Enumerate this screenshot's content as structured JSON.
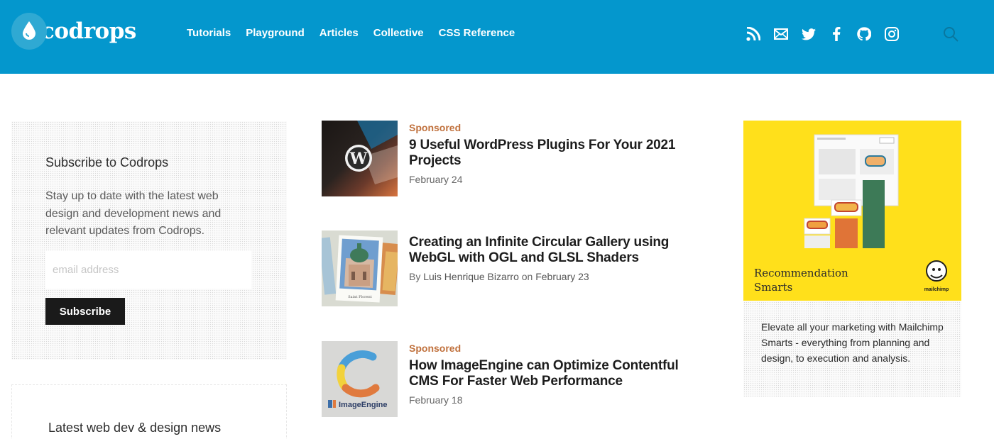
{
  "header": {
    "logo_text": "codrops",
    "nav": [
      "Tutorials",
      "Playground",
      "Articles",
      "Collective",
      "CSS Reference"
    ],
    "social_icons": [
      "rss-icon",
      "mail-icon",
      "twitter-icon",
      "facebook-icon",
      "github-icon",
      "instagram-icon"
    ],
    "search_icon": "search-icon",
    "bg_color": "#0497cd"
  },
  "subscribe": {
    "heading": "Subscribe to Codrops",
    "description": "Stay up to date with the latest web design and development news and relevant updates from Codrops.",
    "email_placeholder": "email address",
    "button_label": "Subscribe"
  },
  "news": {
    "heading": "Latest web dev & design news"
  },
  "articles": [
    {
      "label": "Sponsored",
      "title": "9 Useful WordPress Plugins For Your 2021 Projects",
      "date": "February 24"
    },
    {
      "title": "Creating an Infinite Circular Gallery using WebGL with OGL and GLSL Shaders",
      "by": "By",
      "author": "Luis Henrique Bizarro",
      "on": "on",
      "date": "February 23",
      "thumb_caption": "Saint Florent"
    },
    {
      "label": "Sponsored",
      "title": "How ImageEngine can Optimize Contentful CMS For Faster Web Performance",
      "date": "February 18",
      "thumb_brand": "ImageEngine"
    }
  ],
  "ad": {
    "title": "Recommendation Smarts",
    "brand": "mailchimp",
    "body": "Elevate all your marketing with Mailchimp Smarts - everything from planning and design, to execution and analysis.",
    "bg_color": "#ffe01b"
  }
}
